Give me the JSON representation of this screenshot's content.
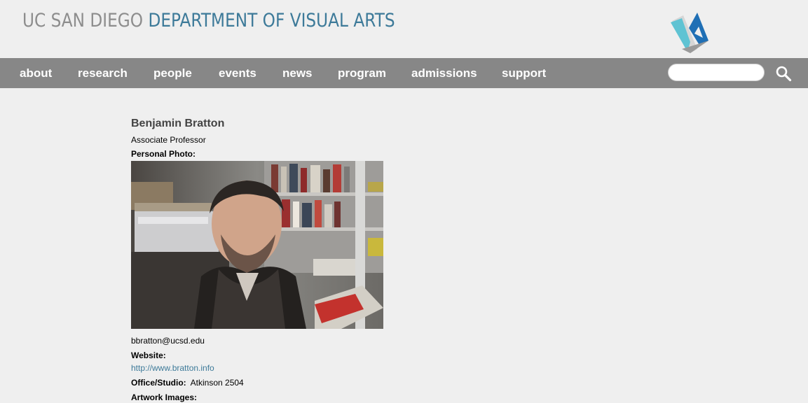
{
  "header": {
    "title_part1": "UC SAN DIEGO",
    "title_part2": "DEPARTMENT OF VISUAL ARTS",
    "logo_icon": "va-logo-icon"
  },
  "nav": {
    "items": [
      "about",
      "research",
      "people",
      "events",
      "news",
      "program",
      "admissions",
      "support"
    ]
  },
  "search": {
    "value": "",
    "placeholder": "",
    "icon": "search-icon"
  },
  "profile": {
    "name": "Benjamin Bratton",
    "title": "Associate Professor",
    "photo_label": "Personal Photo:",
    "email": "bbratton@ucsd.edu",
    "website_label": "Website:",
    "website_url": "http://www.bratton.info",
    "office_label": "Office/Studio:",
    "office_value": "Atkinson 2504",
    "artwork_label": "Artwork Images:"
  },
  "colors": {
    "accent": "#3d7a99",
    "nav_bg": "#878787",
    "page_bg": "#efefef"
  }
}
